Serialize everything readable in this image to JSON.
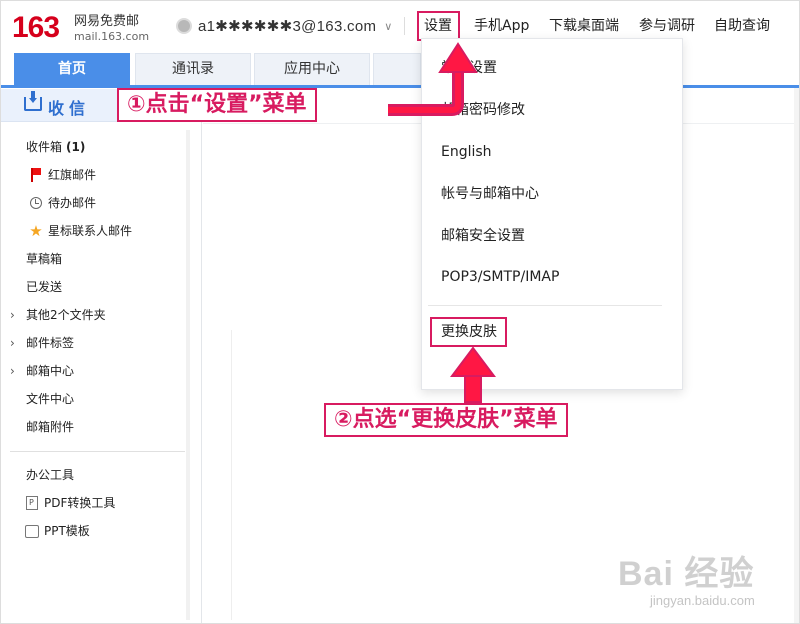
{
  "brand": {
    "number": "163",
    "name_cn": "网易免费邮",
    "domain": "mail.163.com"
  },
  "account": {
    "email": "a1✱✱✱✱✱✱3@163.com",
    "caret": "∨"
  },
  "top_nav": {
    "settings": "设置",
    "mobile_app": "手机App",
    "desktop": "下载桌面端",
    "survey": "参与调研",
    "help": "自助查询"
  },
  "tabs": [
    {
      "label": "首页"
    },
    {
      "label": "通讯录"
    },
    {
      "label": "应用中心"
    }
  ],
  "sidebar": {
    "receive": "收信",
    "inbox": {
      "label": "收件箱",
      "count": "(1)"
    },
    "items": [
      {
        "label": "红旗邮件"
      },
      {
        "label": "待办邮件"
      },
      {
        "label": "星标联系人邮件"
      },
      {
        "label": "草稿箱"
      },
      {
        "label": "已发送"
      },
      {
        "label": "其他2个文件夹"
      },
      {
        "label": "邮件标签"
      },
      {
        "label": "邮箱中心"
      },
      {
        "label": "文件中心"
      },
      {
        "label": "邮箱附件"
      }
    ],
    "office_title": "办公工具",
    "tools": [
      {
        "label": "PDF转换工具"
      },
      {
        "label": "PPT模板"
      }
    ]
  },
  "settings_menu": {
    "items": [
      {
        "label": "常规设置"
      },
      {
        "label": "邮箱密码修改"
      },
      {
        "label": "English"
      },
      {
        "label": "帐号与邮箱中心"
      },
      {
        "label": "邮箱安全设置"
      },
      {
        "label": "POP3/SMTP/IMAP"
      },
      {
        "label": "更换皮肤"
      }
    ]
  },
  "annotations": {
    "step1": "①点击“设置”菜单",
    "step2": "②点选“更换皮肤”菜单",
    "color": "#d81b60"
  },
  "watermark": {
    "logo": "Bai 经验",
    "url": "jingyan.baidu.com"
  },
  "colors": {
    "brand_red": "#d6001c",
    "tab_blue": "#4a8ee8",
    "accent_blue": "#2f6fcf"
  }
}
